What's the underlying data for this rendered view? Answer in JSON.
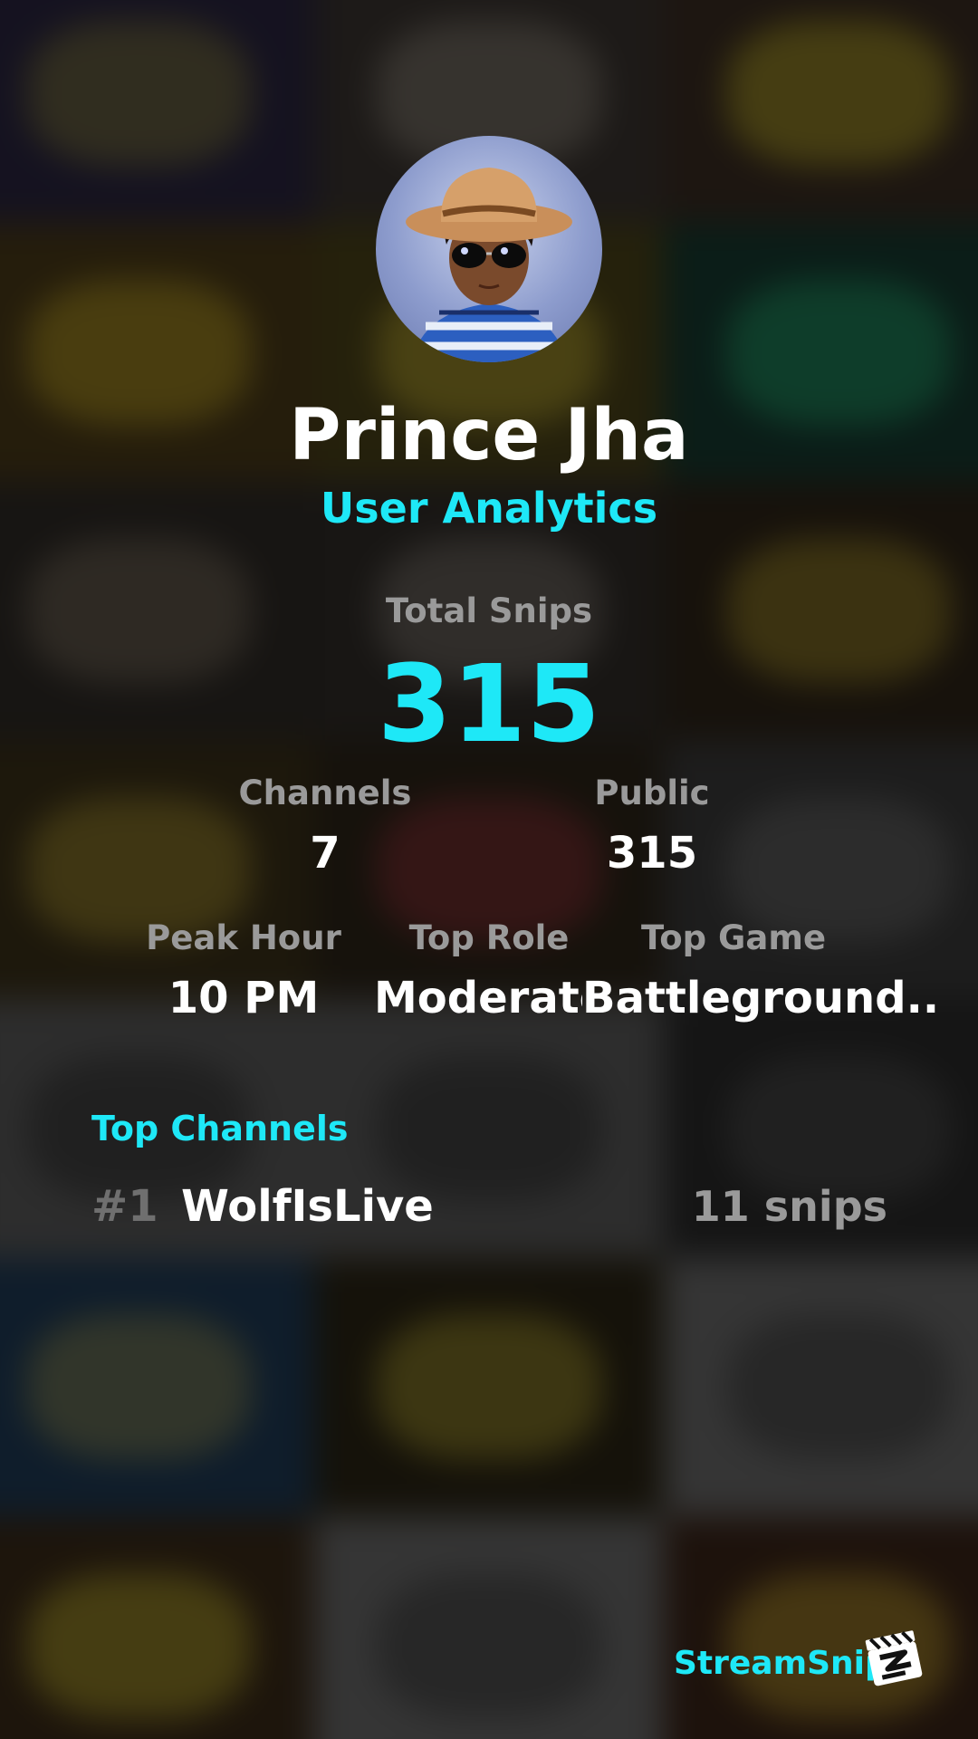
{
  "theme": {
    "accent": "#1ee8f7",
    "label": "#9a9a9a",
    "value": "#ffffff",
    "rank": "#6f6f6f"
  },
  "profile": {
    "name": "Prince Jha",
    "subtitle": "User Analytics",
    "avatar_icon": "user-avatar-photo"
  },
  "stats": {
    "total_label": "Total Snips",
    "total_value": "315",
    "channels_label": "Channels",
    "channels_value": "7",
    "public_label": "Public",
    "public_value": "315",
    "peak_hour_label": "Peak Hour",
    "peak_hour_value": "10 PM",
    "top_role_label": "Top Role",
    "top_role_value": "Moderato",
    "top_game_label": "Top Game",
    "top_game_value": "Battleground.."
  },
  "top_channels": {
    "title": "Top Channels",
    "items": [
      {
        "rank": "#1",
        "name": "WolfIsLive",
        "count": "11 snips"
      }
    ]
  },
  "brand": {
    "name": "StreamSnip",
    "logo_icon": "clapperboard-logo-icon"
  }
}
